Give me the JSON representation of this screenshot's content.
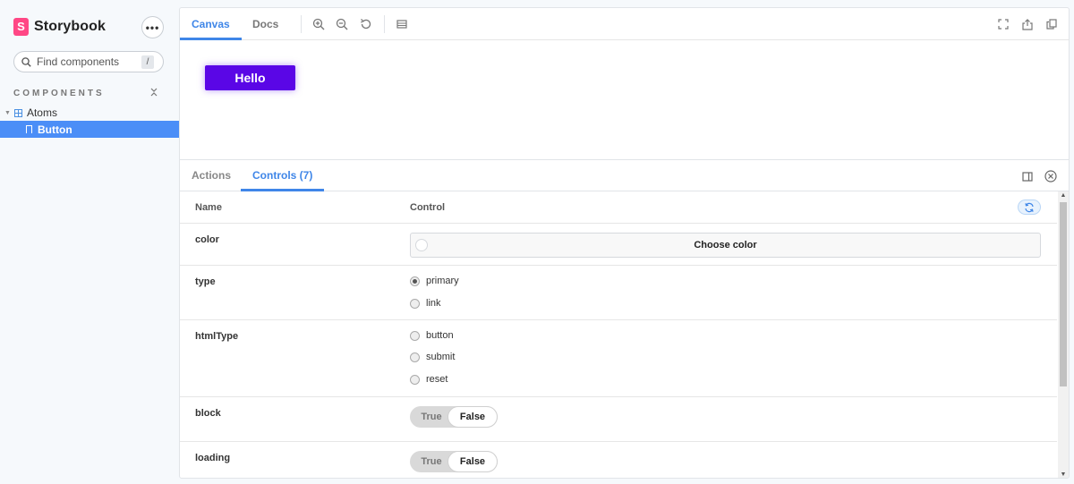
{
  "sidebar": {
    "brand_mark": "S",
    "brand_text": "Storybook",
    "more_label": "•••",
    "search": {
      "placeholder": "Find components",
      "shortcut": "/"
    },
    "section_title": "COMPONENTS",
    "tree": {
      "group_label": "Atoms",
      "item_label": "Button"
    }
  },
  "toolbar": {
    "tabs": [
      {
        "label": "Canvas"
      },
      {
        "label": "Docs"
      }
    ],
    "icons": [
      "zoom-in-icon",
      "zoom-out-icon",
      "zoom-reset-icon",
      "background-icon",
      "fullscreen-icon",
      "share-icon",
      "copy-link-icon"
    ]
  },
  "canvas": {
    "button_label": "Hello"
  },
  "addons": {
    "tabs": [
      {
        "label": "Actions"
      },
      {
        "label": "Controls (7)"
      }
    ],
    "icons": [
      "panel-orientation-icon",
      "close-panel-icon"
    ]
  },
  "controls": {
    "header": {
      "name": "Name",
      "control": "Control"
    },
    "rows": [
      {
        "name": "color",
        "control_label": "Choose color"
      },
      {
        "name": "type",
        "options": [
          "primary",
          "link"
        ],
        "selected": "primary"
      },
      {
        "name": "htmlType",
        "options": [
          "button",
          "submit",
          "reset"
        ]
      },
      {
        "name": "block",
        "true_label": "True",
        "false_label": "False",
        "value": false
      },
      {
        "name": "loading",
        "true_label": "True",
        "false_label": "False",
        "value": false
      }
    ]
  },
  "colors": {
    "accent": "#3f86e8",
    "brand": "#ff4785",
    "button_bg": "#5a06e6",
    "selected_item": "#4b8ef7"
  }
}
